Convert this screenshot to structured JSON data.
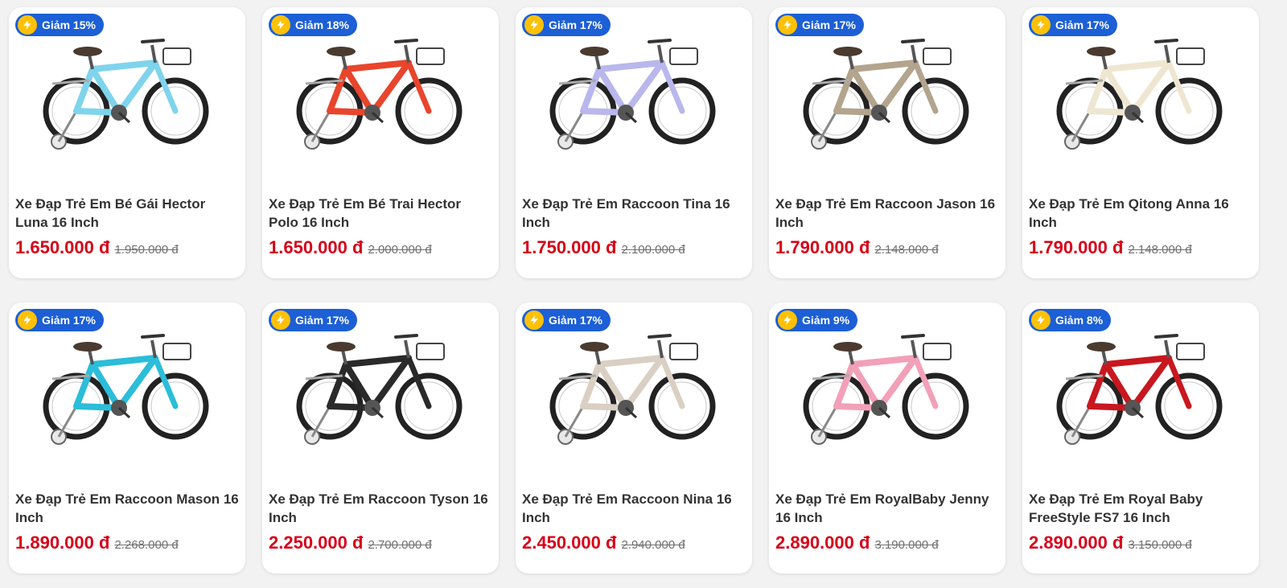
{
  "colors": {
    "badge_bg": "#1c5fd6",
    "bolt_bg": "#ffc107",
    "price": "#d70018",
    "old_price": "#707070"
  },
  "products": [
    {
      "discount": "Giảm 15%",
      "name": "Xe Đạp Trẻ Em Bé Gái Hector Luna 16 Inch",
      "price": "1.650.000 đ",
      "old_price": "1.950.000 đ",
      "frame_color": "#7fd4ec",
      "icon": "bicycle-icon"
    },
    {
      "discount": "Giảm 18%",
      "name": "Xe Đạp Trẻ Em Bé Trai Hector Polo 16 Inch",
      "price": "1.650.000 đ",
      "old_price": "2.000.000 đ",
      "frame_color": "#e8452c",
      "icon": "bicycle-icon"
    },
    {
      "discount": "Giảm 17%",
      "name": "Xe Đạp Trẻ Em Raccoon Tina 16 Inch",
      "price": "1.750.000 đ",
      "old_price": "2.100.000 đ",
      "frame_color": "#b9b7ec",
      "icon": "bicycle-icon"
    },
    {
      "discount": "Giảm 17%",
      "name": "Xe Đạp Trẻ Em Raccoon Jason 16 Inch",
      "price": "1.790.000 đ",
      "old_price": "2.148.000 đ",
      "frame_color": "#b3a48e",
      "icon": "bicycle-icon"
    },
    {
      "discount": "Giảm 17%",
      "name": "Xe Đạp Trẻ Em Qitong Anna 16 Inch",
      "price": "1.790.000 đ",
      "old_price": "2.148.000 đ",
      "frame_color": "#efe6d2",
      "icon": "bicycle-icon"
    },
    {
      "discount": "Giảm 17%",
      "name": "Xe Đạp Trẻ Em Raccoon Mason 16 Inch",
      "price": "1.890.000 đ",
      "old_price": "2.268.000 đ",
      "frame_color": "#2bbdd9",
      "icon": "bicycle-icon"
    },
    {
      "discount": "Giảm 17%",
      "name": "Xe Đạp Trẻ Em Raccoon Tyson 16 Inch",
      "price": "2.250.000 đ",
      "old_price": "2.700.000 đ",
      "frame_color": "#2a2a2a",
      "icon": "bicycle-icon"
    },
    {
      "discount": "Giảm 17%",
      "name": "Xe Đạp Trẻ Em Raccoon Nina 16 Inch",
      "price": "2.450.000 đ",
      "old_price": "2.940.000 đ",
      "frame_color": "#d9cfc2",
      "icon": "bicycle-icon"
    },
    {
      "discount": "Giảm 9%",
      "name": "Xe Đạp Trẻ Em RoyalBaby Jenny 16 Inch",
      "price": "2.890.000 đ",
      "old_price": "3.190.000 đ",
      "frame_color": "#f2a0b8",
      "icon": "bicycle-icon"
    },
    {
      "discount": "Giảm 8%",
      "name": "Xe Đạp Trẻ Em Royal Baby FreeStyle FS7 16 Inch",
      "price": "2.890.000 đ",
      "old_price": "3.150.000 đ",
      "frame_color": "#c8171e",
      "icon": "bicycle-icon"
    }
  ]
}
